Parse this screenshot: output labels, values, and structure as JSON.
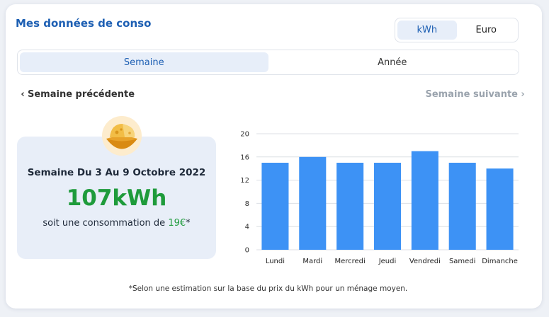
{
  "header": {
    "title": "Mes données de conso"
  },
  "unit_toggle": {
    "options": [
      "kWh",
      "Euro"
    ],
    "selected": "kWh"
  },
  "period_tabs": {
    "options": [
      "Semaine",
      "Année"
    ],
    "selected": "Semaine"
  },
  "nav": {
    "prev_label": "Semaine précédente",
    "next_label": "Semaine suivante"
  },
  "summary": {
    "period": "Semaine Du 3 Au 9 Octobre 2022",
    "value": "107kWh",
    "cost_prefix": "soit une consommation de ",
    "cost_value": "19€",
    "cost_suffix": "*"
  },
  "colors": {
    "accent": "#1d5fb3",
    "bar": "#3d92f5",
    "green": "#1e9b3b"
  },
  "chart_data": {
    "type": "bar",
    "categories": [
      "Lundi",
      "Mardi",
      "Mercredi",
      "Jeudi",
      "Vendredi",
      "Samedi",
      "Dimanche"
    ],
    "values": [
      15,
      16,
      15,
      15,
      17,
      15,
      14
    ],
    "yticks": [
      0,
      4,
      8,
      12,
      16,
      20
    ],
    "ylim": [
      0,
      20
    ],
    "grid": true
  },
  "footnote": "*Selon une estimation sur la base du prix du kWh pour un ménage moyen."
}
